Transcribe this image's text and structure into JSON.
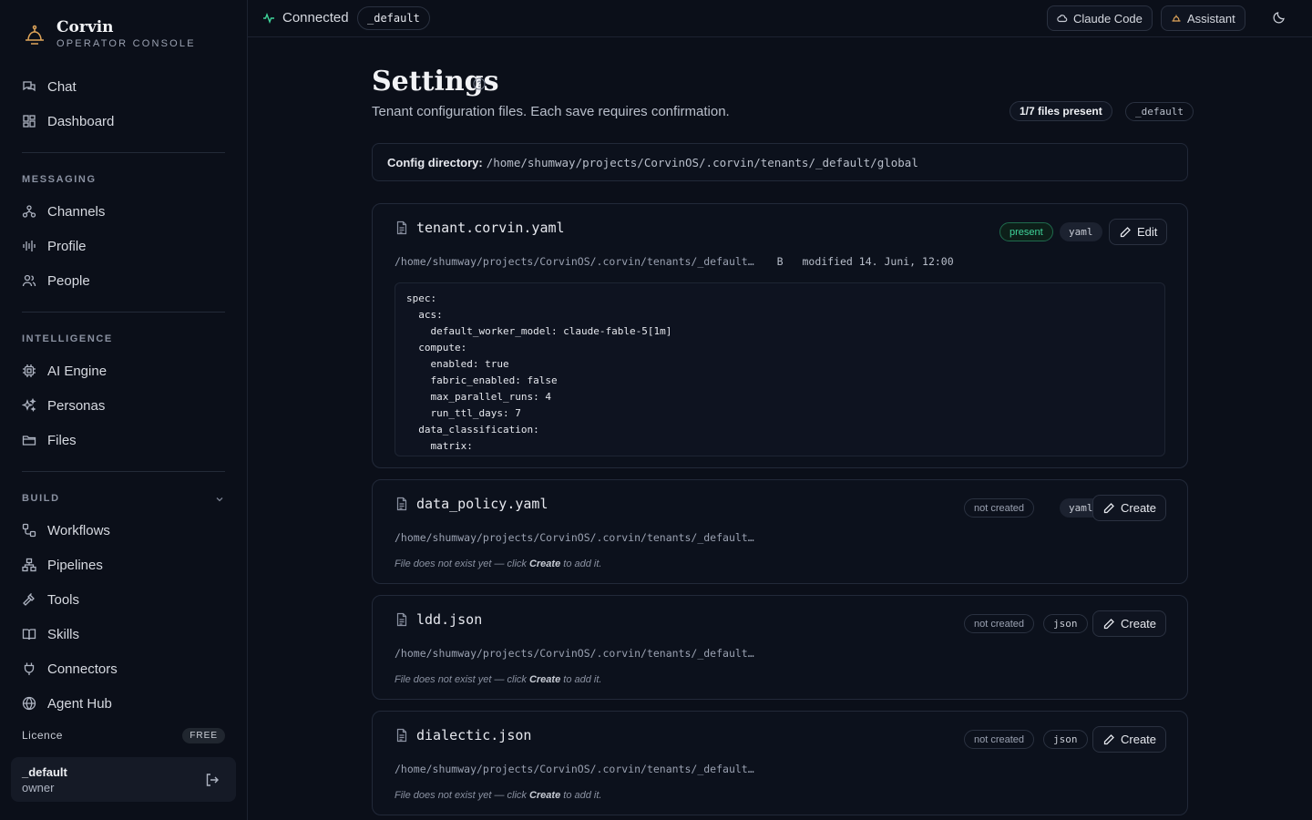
{
  "brand": {
    "name": "Corvin",
    "subtitle": "OPERATOR CONSOLE"
  },
  "sidebar": {
    "top_items": [
      {
        "label": "Chat",
        "icon": "chat-icon"
      },
      {
        "label": "Dashboard",
        "icon": "dashboard-icon"
      }
    ],
    "sections": [
      {
        "title": "MESSAGING",
        "items": [
          {
            "label": "Channels",
            "icon": "channels-icon"
          },
          {
            "label": "Profile",
            "icon": "audio-wave-icon"
          },
          {
            "label": "People",
            "icon": "people-icon"
          }
        ]
      },
      {
        "title": "INTELLIGENCE",
        "items": [
          {
            "label": "AI Engine",
            "icon": "cpu-icon"
          },
          {
            "label": "Personas",
            "icon": "sparkles-icon"
          },
          {
            "label": "Files",
            "icon": "folder-icon"
          }
        ]
      },
      {
        "title": "BUILD",
        "items": [
          {
            "label": "Workflows",
            "icon": "workflow-icon"
          },
          {
            "label": "Pipelines",
            "icon": "pipeline-icon"
          },
          {
            "label": "Tools",
            "icon": "hammer-icon"
          },
          {
            "label": "Skills",
            "icon": "book-icon"
          },
          {
            "label": "Connectors",
            "icon": "plug-icon"
          },
          {
            "label": "Agent Hub",
            "icon": "globe-icon"
          }
        ]
      }
    ],
    "licence": {
      "label": "Licence",
      "badge": "FREE"
    },
    "user": {
      "name": "_default",
      "role": "owner"
    }
  },
  "topbar": {
    "status": "Connected",
    "tenant": "_default",
    "claude_code_label": "Claude Code",
    "assistant_label": "Assistant"
  },
  "main": {
    "title": "Settings",
    "subtitle": "Tenant configuration files. Each save requires confirmation.",
    "files_count": "1/7 files present",
    "tenant_badge": "_default",
    "config_dir_label": "Config directory:",
    "config_dir_path": "/home/shumway/projects/CorvinOS/.corvin/tenants/_default/global",
    "files": [
      {
        "name": "tenant.corvin.yaml",
        "status": "present",
        "type": "yaml",
        "action": "Edit",
        "path": "/home/shumway/projects/CorvinOS/.corvin/tenants/_default…",
        "size": "B",
        "modified": "modified 14. Juni, 12:00",
        "content": "spec:\n  acs:\n    default_worker_model: claude-fable-5[1m]\n  compute:\n    enabled: true\n    fabric_enabled: false\n    max_parallel_runs: 4\n    run_ttl_days: 7\n  data_classification:\n    matrix:"
      },
      {
        "name": "data_policy.yaml",
        "status": "not created",
        "type": "yaml",
        "action": "Create",
        "path": "/home/shumway/projects/CorvinOS/.corvin/tenants/_default…",
        "hint_pre": "File does not exist yet — click ",
        "hint_bold": "Create",
        "hint_post": " to add it."
      },
      {
        "name": "ldd.json",
        "status": "not created",
        "type": "json",
        "action": "Create",
        "path": "/home/shumway/projects/CorvinOS/.corvin/tenants/_default…",
        "hint_pre": "File does not exist yet — click ",
        "hint_bold": "Create",
        "hint_post": " to add it."
      },
      {
        "name": "dialectic.json",
        "status": "not created",
        "type": "json",
        "action": "Create",
        "path": "/home/shumway/projects/CorvinOS/.corvin/tenants/_default…",
        "hint_pre": "File does not exist yet — click ",
        "hint_bold": "Create",
        "hint_post": " to add it."
      }
    ]
  },
  "colors": {
    "accent_green": "#3fd49a",
    "background": "#0b0f19",
    "card": "#0c111c"
  }
}
